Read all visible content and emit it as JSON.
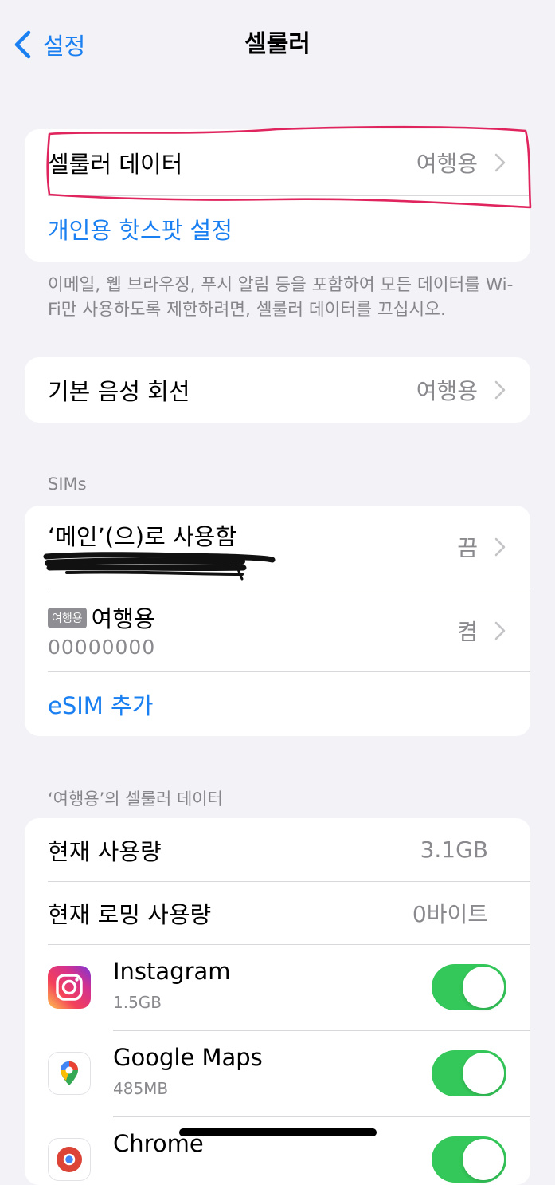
{
  "nav": {
    "back_label": "설정",
    "title": "셀룰러"
  },
  "cellular_card": {
    "cellular_data_label": "셀룰러 데이터",
    "cellular_data_value": "여행용",
    "hotspot_label": "개인용 핫스팟 설정"
  },
  "footnote": "이메일, 웹 브라우징, 푸시 알림 등을 포함하여 모든 데이터를 Wi-Fi만 사용하도록 제한하려면, 셀룰러 데이터를 끄십시오.",
  "voice_card": {
    "label": "기본 음성 회선",
    "value": "여행용"
  },
  "sims": {
    "header": "SIMs",
    "main_label": "‘메인’(으)로 사용함",
    "main_value": "끔",
    "travel_badge": "여행용",
    "travel_label": "여행용",
    "travel_number": "00000000",
    "travel_value": "켬",
    "add_esim_label": "eSIM 추가"
  },
  "usage": {
    "header": "‘여행용’의 셀룰러 데이터",
    "current_label": "현재 사용량",
    "current_value": "3.1GB",
    "roaming_label": "현재 로밍 사용량",
    "roaming_value": "0바이트",
    "apps": [
      {
        "name": "Instagram",
        "size": "1.5GB",
        "enabled": true,
        "icon": "instagram-icon"
      },
      {
        "name": "Google Maps",
        "size": "485MB",
        "enabled": true,
        "icon": "google-maps-icon"
      },
      {
        "name": "Chrome",
        "size": "",
        "enabled": true,
        "icon": "chrome-icon"
      }
    ]
  },
  "colors": {
    "accent": "#1a7ff0",
    "toggle_on": "#34c759",
    "annotation": "#e0245e",
    "background": "#f2f2f7"
  }
}
